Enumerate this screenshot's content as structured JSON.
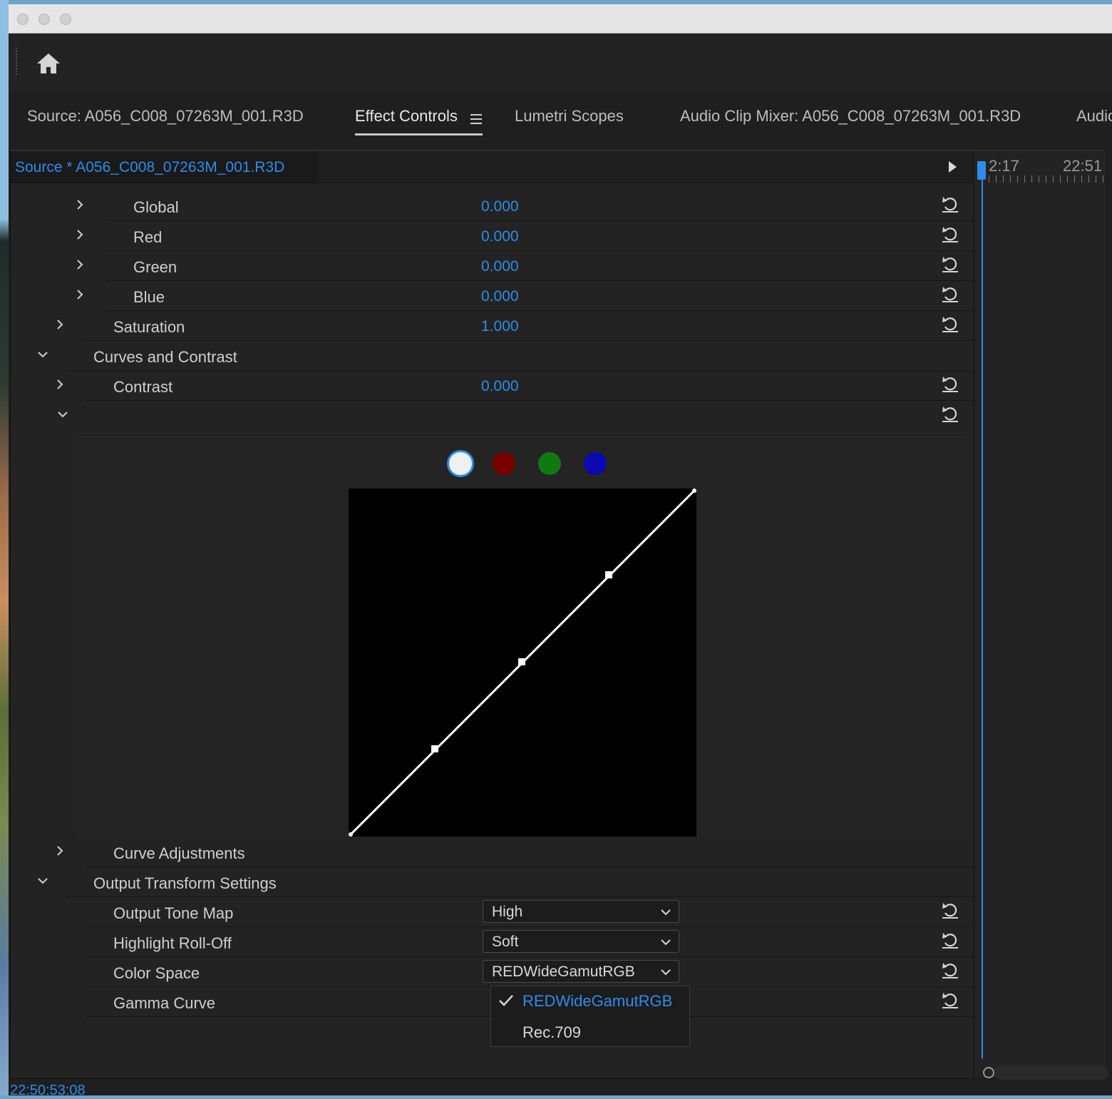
{
  "tabs": [
    {
      "label": "Source: A056_C008_07263M_001.R3D"
    },
    {
      "label": "Effect Controls"
    },
    {
      "label": "Lumetri Scopes"
    },
    {
      "label": "Audio Clip Mixer: A056_C008_07263M_001.R3D"
    },
    {
      "label": "Audio"
    }
  ],
  "panel": {
    "source_label": "Source * A056_C008_07263M_001.R3D",
    "timeline": {
      "timecode_1": "2:17",
      "timecode_2": "22:51"
    }
  },
  "params": {
    "global": {
      "label": "Global",
      "value": "0.000"
    },
    "red": {
      "label": "Red",
      "value": "0.000"
    },
    "green": {
      "label": "Green",
      "value": "0.000"
    },
    "blue": {
      "label": "Blue",
      "value": "0.000"
    },
    "saturation": {
      "label": "Saturation",
      "value": "1.000"
    },
    "curves_section": {
      "label": "Curves and Contrast"
    },
    "contrast": {
      "label": "Contrast",
      "value": "0.000"
    },
    "curve_adjustments": {
      "label": "Curve Adjustments"
    },
    "output_section": {
      "label": "Output Transform Settings"
    },
    "output_tone_map": {
      "label": "Output Tone Map",
      "selected": "High"
    },
    "highlight_rolloff": {
      "label": "Highlight Roll-Off",
      "selected": "Soft"
    },
    "color_space": {
      "label": "Color Space",
      "selected": "REDWideGamutRGB"
    },
    "gamma_curve": {
      "label": "Gamma Curve"
    }
  },
  "curve_channels": [
    {
      "name": "white",
      "color": "#f0f0f0"
    },
    {
      "name": "red",
      "color": "#7a0000"
    },
    {
      "name": "green",
      "color": "#0f7a0f"
    },
    {
      "name": "blue",
      "color": "#0a0ab0"
    }
  ],
  "color_space_menu": {
    "items": [
      {
        "label": "REDWideGamutRGB",
        "checked": true
      },
      {
        "label": "Rec.709",
        "checked": false
      }
    ]
  },
  "colors": {
    "accent": "#2d8ceb",
    "panel_bg": "#232323"
  },
  "footer": {
    "timecode": "22:50:53:08"
  }
}
